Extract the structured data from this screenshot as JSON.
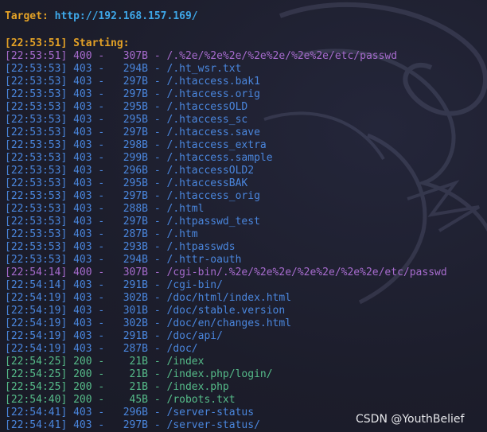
{
  "header": {
    "target_label": "Target: ",
    "target_url": "http://192.168.157.169/",
    "starting": "[22:53:51] Starting:"
  },
  "colors": {
    "background": "#1c1d2b",
    "timestamp_status_orange": "#e3a126",
    "url_blue": "#3ea7e8",
    "status_400": "#a66bcd",
    "status_403": "#4a86dd",
    "status_200": "#56bc8a"
  },
  "log": [
    {
      "time": "22:53:51",
      "code": "400",
      "size": "307B",
      "path": "/.%2e/%2e%2e/%2e%2e/%2e%2e/etc/passwd"
    },
    {
      "time": "22:53:53",
      "code": "403",
      "size": "294B",
      "path": "/.ht_wsr.txt"
    },
    {
      "time": "22:53:53",
      "code": "403",
      "size": "297B",
      "path": "/.htaccess.bak1"
    },
    {
      "time": "22:53:53",
      "code": "403",
      "size": "297B",
      "path": "/.htaccess.orig"
    },
    {
      "time": "22:53:53",
      "code": "403",
      "size": "295B",
      "path": "/.htaccessOLD"
    },
    {
      "time": "22:53:53",
      "code": "403",
      "size": "295B",
      "path": "/.htaccess_sc"
    },
    {
      "time": "22:53:53",
      "code": "403",
      "size": "297B",
      "path": "/.htaccess.save"
    },
    {
      "time": "22:53:53",
      "code": "403",
      "size": "298B",
      "path": "/.htaccess_extra"
    },
    {
      "time": "22:53:53",
      "code": "403",
      "size": "299B",
      "path": "/.htaccess.sample"
    },
    {
      "time": "22:53:53",
      "code": "403",
      "size": "296B",
      "path": "/.htaccessOLD2"
    },
    {
      "time": "22:53:53",
      "code": "403",
      "size": "295B",
      "path": "/.htaccessBAK"
    },
    {
      "time": "22:53:53",
      "code": "403",
      "size": "297B",
      "path": "/.htaccess_orig"
    },
    {
      "time": "22:53:53",
      "code": "403",
      "size": "288B",
      "path": "/.html"
    },
    {
      "time": "22:53:53",
      "code": "403",
      "size": "297B",
      "path": "/.htpasswd_test"
    },
    {
      "time": "22:53:53",
      "code": "403",
      "size": "287B",
      "path": "/.htm"
    },
    {
      "time": "22:53:53",
      "code": "403",
      "size": "293B",
      "path": "/.htpasswds"
    },
    {
      "time": "22:53:53",
      "code": "403",
      "size": "294B",
      "path": "/.httr-oauth"
    },
    {
      "time": "22:54:14",
      "code": "400",
      "size": "307B",
      "path": "/cgi-bin/.%2e/%2e%2e/%2e%2e/%2e%2e/etc/passwd"
    },
    {
      "time": "22:54:14",
      "code": "403",
      "size": "291B",
      "path": "/cgi-bin/"
    },
    {
      "time": "22:54:19",
      "code": "403",
      "size": "302B",
      "path": "/doc/html/index.html"
    },
    {
      "time": "22:54:19",
      "code": "403",
      "size": "301B",
      "path": "/doc/stable.version"
    },
    {
      "time": "22:54:19",
      "code": "403",
      "size": "302B",
      "path": "/doc/en/changes.html"
    },
    {
      "time": "22:54:19",
      "code": "403",
      "size": "291B",
      "path": "/doc/api/"
    },
    {
      "time": "22:54:19",
      "code": "403",
      "size": "287B",
      "path": "/doc/"
    },
    {
      "time": "22:54:25",
      "code": "200",
      "size": "21B",
      "path": "/index"
    },
    {
      "time": "22:54:25",
      "code": "200",
      "size": "21B",
      "path": "/index.php/login/"
    },
    {
      "time": "22:54:25",
      "code": "200",
      "size": "21B",
      "path": "/index.php"
    },
    {
      "time": "22:54:40",
      "code": "200",
      "size": "45B",
      "path": "/robots.txt"
    },
    {
      "time": "22:54:41",
      "code": "403",
      "size": "296B",
      "path": "/server-status"
    },
    {
      "time": "22:54:41",
      "code": "403",
      "size": "297B",
      "path": "/server-status/"
    }
  ],
  "watermark": "CSDN @YouthBelief",
  "decoration": {
    "background_icon": "kali-dragon-icon"
  }
}
